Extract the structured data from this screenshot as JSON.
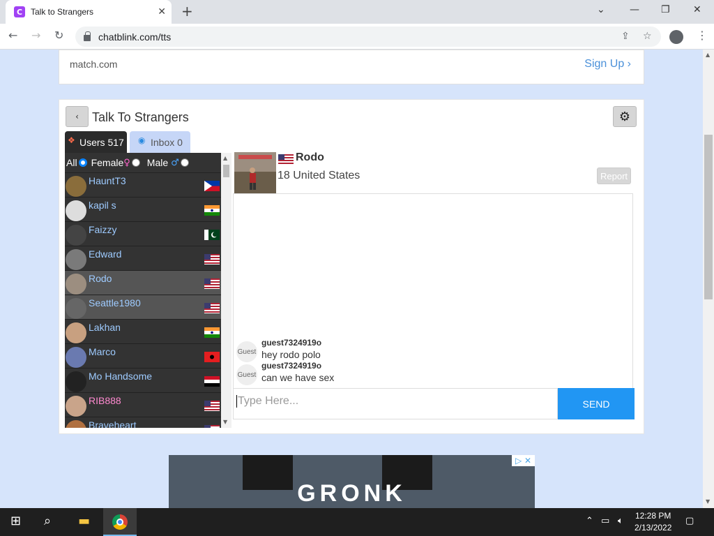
{
  "browser": {
    "tab_title": "Talk to Strangers",
    "tab_favicon_letter": "C",
    "url": "chatblink.com/tts",
    "new_tab_label": "+",
    "close_tab_label": "✕"
  },
  "top_ad": {
    "left_text": "match.com",
    "right_text": "Sign Up ›"
  },
  "panel": {
    "title": "Talk To Strangers",
    "back_label": "‹",
    "gear_label": "⚙",
    "tabs": {
      "users": "Users 517",
      "inbox": "Inbox 0"
    },
    "filter": {
      "all": "All",
      "female": "Female",
      "female_symbol": "♀",
      "male": "Male",
      "male_symbol": "♂"
    }
  },
  "users": [
    {
      "name": "HauntT3",
      "flag": "philippines",
      "gender": "male"
    },
    {
      "name": "kapil s",
      "flag": "india",
      "gender": "male"
    },
    {
      "name": "Faizzy",
      "flag": "pakistan",
      "gender": "male"
    },
    {
      "name": "Edward",
      "flag": "usa",
      "gender": "male"
    },
    {
      "name": "Rodo",
      "flag": "usa",
      "gender": "male",
      "selected": true
    },
    {
      "name": "Seattle1980",
      "flag": "usa",
      "gender": "male",
      "selected": true
    },
    {
      "name": "Lakhan",
      "flag": "india",
      "gender": "male"
    },
    {
      "name": "Marco",
      "flag": "albania",
      "gender": "male"
    },
    {
      "name": "Mo Handsome",
      "flag": "egypt",
      "gender": "male"
    },
    {
      "name": "RIB888",
      "flag": "usa",
      "gender": "female"
    },
    {
      "name": "Braveheart",
      "flag": "usa",
      "gender": "male"
    }
  ],
  "chat": {
    "name": "Rodo",
    "location": "18 United States",
    "report_label": "Report",
    "guest_label": "Guest",
    "messages": [
      {
        "user": "guest7324919o",
        "text": "hey rodo polo"
      },
      {
        "user": "guest7324919o",
        "text": "can we have sex"
      }
    ],
    "input_placeholder": "Type Here...",
    "send_label": "SEND"
  },
  "bottom_ad": {
    "text": "GRONK",
    "icons": "▷ ✕"
  },
  "taskbar": {
    "time": "12:28 PM",
    "date": "2/13/2022"
  },
  "colors": {
    "send": "#2196f3",
    "male_name": "#9ecbff",
    "female_name": "#ff8ad0",
    "list_bg": "#333333"
  }
}
